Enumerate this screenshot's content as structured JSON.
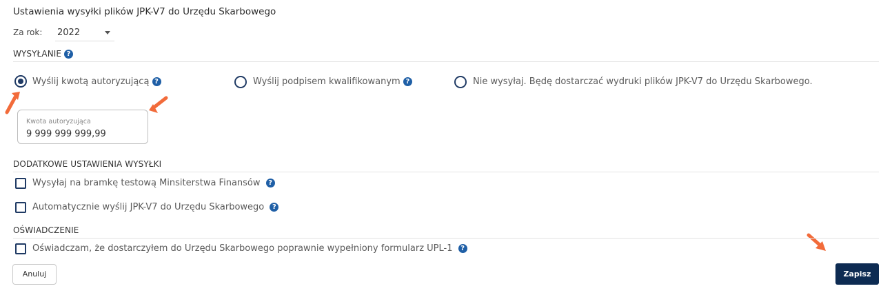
{
  "header": {
    "title": "Ustawienia wysyłki plików JPK-V7 do Urzędu Skarbowego"
  },
  "year": {
    "label": "Za rok:",
    "value": "2022"
  },
  "sending": {
    "section_title": "WYSYŁANIE",
    "options": [
      {
        "label": "Wyślij kwotą autoryzującą",
        "selected": true
      },
      {
        "label": "Wyślij podpisem kwalifikowanym",
        "selected": false
      },
      {
        "label": "Nie wysyłaj. Będę dostarczać wydruki plików JPK-V7 do Urzędu Skarbowego.",
        "selected": false
      }
    ],
    "amount_field": {
      "label": "Kwota autoryzująca",
      "value": "9 999 999 999,99"
    }
  },
  "additional": {
    "section_title": "DODATKOWE USTAWIENIA WYSYŁKI",
    "checkboxes": [
      {
        "label": "Wysyłaj na bramkę testową Minsiterstwa Finansów",
        "checked": false
      },
      {
        "label": "Automatycznie wyślij JPK-V7 do Urzędu Skarbowego",
        "checked": false
      }
    ]
  },
  "statement": {
    "section_title": "OŚWIADCZENIE",
    "checkbox": {
      "label": "Oświadczam, że dostarczyłem do Urzędu Skarbowego poprawnie wypełniony formularz UPL-1",
      "checked": false
    }
  },
  "actions": {
    "cancel_label": "Anuluj",
    "save_label": "Zapisz"
  },
  "help_icon_glyph": "?",
  "colors": {
    "accent": "#0d2b52",
    "help": "#1f5fa6",
    "annotation_arrow": "#f26b3a"
  }
}
